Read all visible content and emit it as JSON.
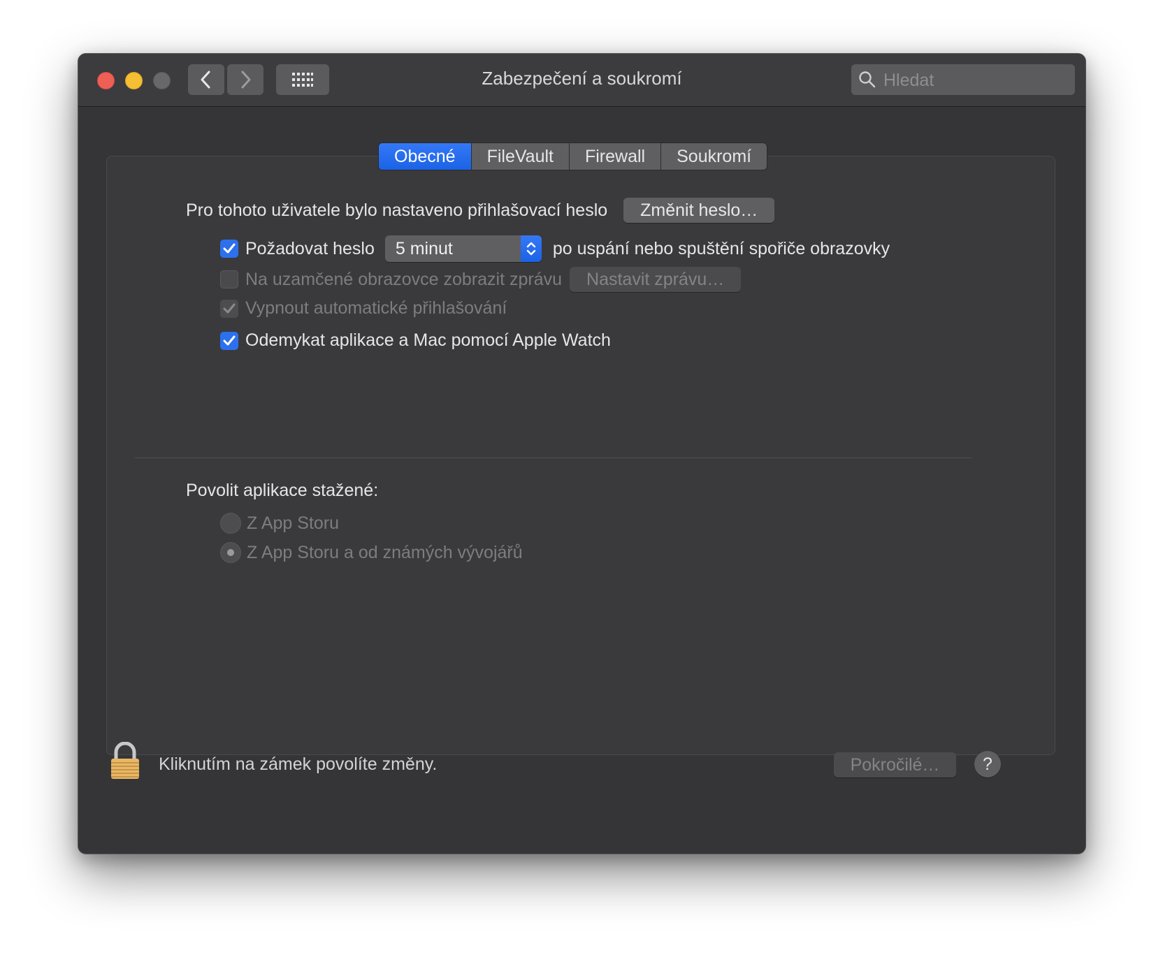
{
  "window": {
    "title": "Zabezpečení a soukromí"
  },
  "toolbar": {
    "search_placeholder": "Hledat"
  },
  "tabs": [
    {
      "label": "Obecné",
      "active": true
    },
    {
      "label": "FileVault",
      "active": false
    },
    {
      "label": "Firewall",
      "active": false
    },
    {
      "label": "Soukromí",
      "active": false
    }
  ],
  "general": {
    "password_set_text": "Pro tohoto uživatele bylo nastaveno přihlašovací heslo",
    "change_password_button": "Změnit heslo…",
    "require_password": {
      "checked": true,
      "label": "Požadovat heslo",
      "delay_value": "5 minut",
      "suffix": "po uspání nebo spuštění spořiče obrazovky"
    },
    "lock_message": {
      "checked": false,
      "enabled": false,
      "label": "Na uzamčené obrazovce zobrazit zprávu",
      "button": "Nastavit zprávu…"
    },
    "disable_auto_login": {
      "checked": true,
      "enabled": false,
      "label": "Vypnout automatické přihlašování"
    },
    "apple_watch_unlock": {
      "checked": true,
      "label": "Odemykat aplikace a Mac pomocí Apple Watch"
    }
  },
  "downloads": {
    "heading": "Povolit aplikace stažené:",
    "options": [
      {
        "label": "Z App Storu",
        "selected": false,
        "enabled": false
      },
      {
        "label": "Z App Storu a od známých vývojářů",
        "selected": true,
        "enabled": false
      }
    ]
  },
  "footer": {
    "lock_text": "Kliknutím na zámek povolíte změny.",
    "advanced_button": "Pokročilé…",
    "help_button": "?"
  },
  "colors": {
    "accent": "#2d70ee",
    "window_background": "#353537",
    "close": "#ee5f56",
    "minimize": "#f5be33",
    "zoom_disabled": "#68686b"
  }
}
